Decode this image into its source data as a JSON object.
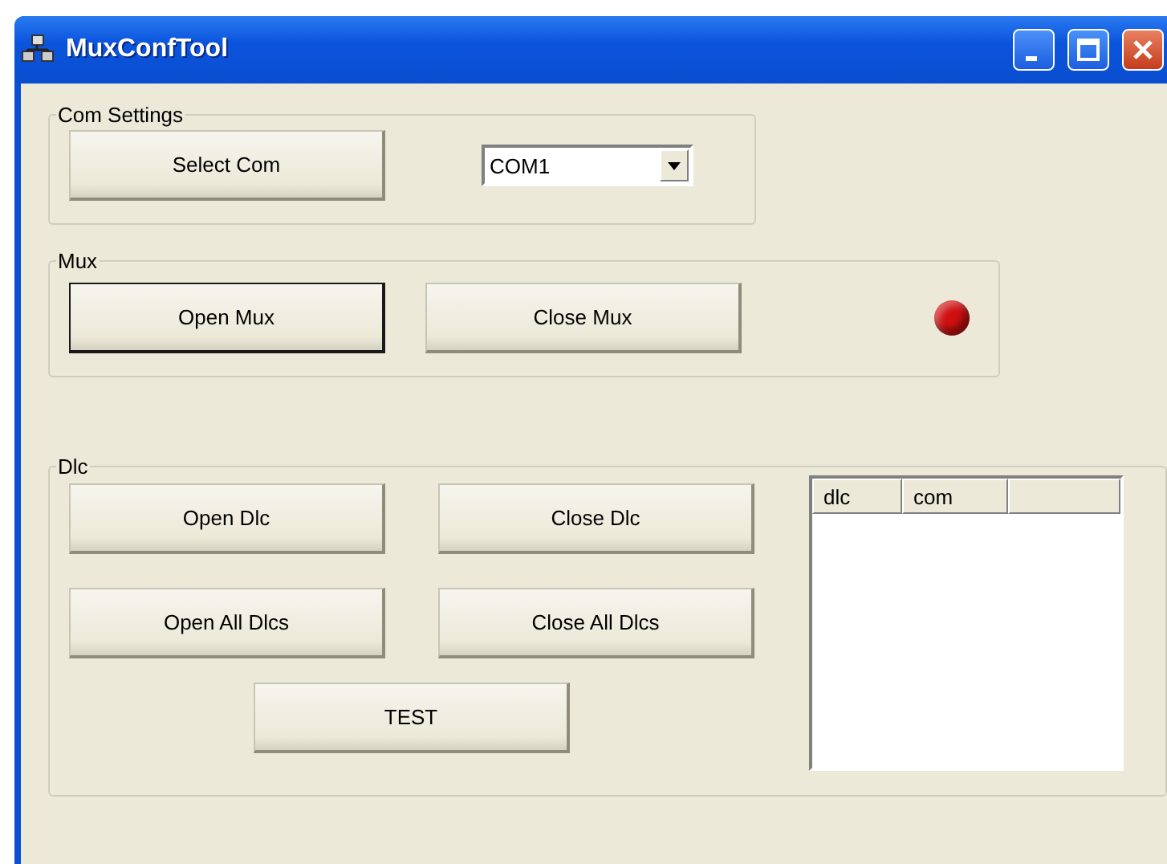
{
  "window": {
    "title": "MuxConfTool"
  },
  "com_settings": {
    "title": "Com Settings",
    "button": "Select Com",
    "port": {
      "value": "COM1"
    }
  },
  "mux": {
    "title": "Mux",
    "buttons": [
      {
        "label": "Open Mux",
        "focused": true
      },
      {
        "label": "Close Mux",
        "focused": false
      }
    ],
    "led": {
      "color": "#d01010"
    }
  },
  "dlc": {
    "title": "Dlc",
    "buttons": [
      {
        "label": "Open Dlc"
      },
      {
        "label": "Close Dlc"
      },
      {
        "label": "Open All Dlcs"
      },
      {
        "label": "Close All Dlcs"
      }
    ],
    "test_button": "TEST",
    "list": {
      "columns": [
        "dlc",
        "com",
        ""
      ]
    }
  }
}
